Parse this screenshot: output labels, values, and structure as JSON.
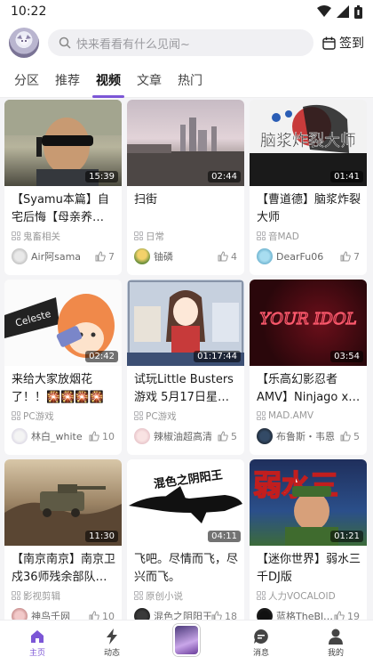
{
  "status": {
    "time": "10:22"
  },
  "header": {
    "search_placeholder": "快来看看有什么见闻~",
    "checkin_label": "签到"
  },
  "tabs": [
    {
      "label": "分区",
      "active": false
    },
    {
      "label": "推荐",
      "active": false
    },
    {
      "label": "视频",
      "active": true
    },
    {
      "label": "文章",
      "active": false
    },
    {
      "label": "热门",
      "active": false
    }
  ],
  "cards": [
    {
      "duration": "15:39",
      "title": "【Syamu本篇】自宅后悔【母亲养…",
      "category": "鬼畜相关",
      "uploader": "Air阿sama",
      "likes": "7"
    },
    {
      "duration": "02:44",
      "title": "扫街",
      "category": "日常",
      "uploader": "铀磷",
      "likes": "4"
    },
    {
      "duration": "01:41",
      "title": "【曹道德】脑浆炸裂大师",
      "category": "音MAD",
      "uploader": "DearFu06",
      "likes": "7"
    },
    {
      "duration": "02:42",
      "title": "来给大家放烟花了！！🎇🎇🎇🎇",
      "category": "PC游戏",
      "uploader": "林白_white",
      "likes": "10"
    },
    {
      "duration": "01:17:44",
      "title": "试玩Little Busters游戏 5月17日星期四",
      "category": "PC游戏",
      "uploader": "辣椒油超高清",
      "likes": "5"
    },
    {
      "duration": "03:54",
      "title": "【乐高幻影忍者 AMV】Ninjago x K-P…",
      "category": "MAD.AMV",
      "uploader": "布鲁斯・韦恩",
      "likes": "5"
    },
    {
      "duration": "11:30",
      "title": "【南京南京】南京卫戍36师残余部队…",
      "category": "影视剪辑",
      "uploader": "神鸟千网",
      "likes": "10"
    },
    {
      "duration": "04:11",
      "title": "飞吧。尽情而飞，尽兴而飞。",
      "category": "原创小说",
      "uploader": "混色之阴阳王",
      "likes": "18"
    },
    {
      "duration": "01:21",
      "title": "【迷你世界】弱水三千DJ版",
      "category": "人力VOCALOID",
      "uploader": "蓝格TheBl…",
      "likes": "19"
    }
  ],
  "thumb_text": {
    "card3": "脑浆炸裂大师",
    "card4": "Celeste",
    "card6": "YOUR IDOL",
    "card8": "混色之阴阳王",
    "card9": "弱水三"
  },
  "bottom_nav": [
    {
      "label": "主页",
      "icon": "home-icon",
      "active": true
    },
    {
      "label": "动态",
      "icon": "bolt-icon",
      "active": false
    },
    {
      "label": "",
      "icon": "center-avatar",
      "active": false
    },
    {
      "label": "消息",
      "icon": "message-icon",
      "active": false
    },
    {
      "label": "我的",
      "icon": "user-icon",
      "active": false
    }
  ],
  "colors": {
    "accent": "#7c56d6",
    "background": "#f4f4f6"
  }
}
